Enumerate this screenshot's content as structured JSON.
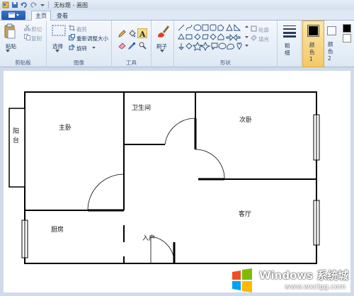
{
  "window": {
    "title": "无标题 - 画图"
  },
  "tabs": {
    "home": "主页",
    "view": "查看"
  },
  "ribbon": {
    "clipboard": {
      "paste": "粘贴",
      "cut": "剪切",
      "copy": "复制",
      "group": "剪贴板"
    },
    "image": {
      "select": "选择",
      "crop": "裁剪",
      "resize": "重新调整大小",
      "rotate": "旋转",
      "group": "图像"
    },
    "tools": {
      "group": "工具"
    },
    "brushes": {
      "label": "刷子"
    },
    "shapes": {
      "outline": "轮廓",
      "fill": "填充",
      "group": "形状"
    },
    "size": {
      "label": "粗细"
    },
    "colors": {
      "color1": "颜色 1",
      "color2": "颜色 2",
      "color1_value": "#000000",
      "color2_value": "#ffffff"
    }
  },
  "floorplan": {
    "rooms": {
      "balcony": "阳台",
      "master_bedroom": "主卧",
      "bathroom": "卫生间",
      "second_bedroom": "次卧",
      "living_room": "客厅",
      "kitchen": "厨房",
      "entrance": "入户"
    }
  },
  "watermark": {
    "title": "Windows 系统城",
    "url": "www.wxclgg.com"
  }
}
